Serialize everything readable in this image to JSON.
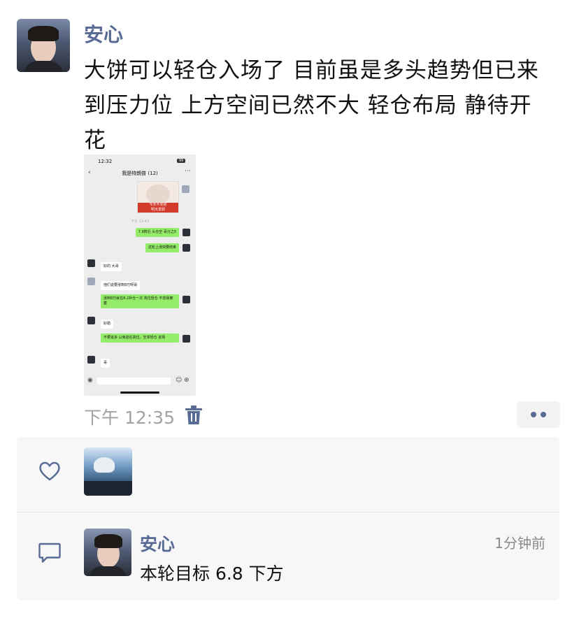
{
  "post": {
    "author": "安心",
    "text_lines": [
      "大饼可以轻仓入场了     目前虽是多头趋势但已来",
      "到压力位  上方空间已然不大   轻仓布局  静待开",
      "花"
    ],
    "time": "下午 12:35",
    "icons": {
      "delete": "trash-icon",
      "more": "more-dots-icon"
    }
  },
  "screenshot": {
    "status_time": "12:32",
    "battery": "99",
    "chat_title": "我是特朗普 (12)",
    "meme_text": [
      "今天不发财",
      "明天发财"
    ],
    "system_note": "下午 12:43",
    "messages": [
      {
        "side": "right",
        "text": "7.9附近 头仓空 百分之5"
      },
      {
        "side": "right",
        "text": "这轮上涨快要结束"
      },
      {
        "side": "left",
        "text": "好的 大哥"
      },
      {
        "side": "left",
        "text": "他们说要涨到8万呀哥"
      },
      {
        "side": "right",
        "text": "涨到8万就在8.2补仓一次 高位轻仓 不容易被套"
      },
      {
        "side": "left",
        "text": "好勒"
      },
      {
        "side": "right",
        "text": "不要追多 以免挂在高位。空单轻仓 进场"
      },
      {
        "side": "left",
        "text": "哥"
      }
    ]
  },
  "likes": {
    "icon": "heart-icon"
  },
  "comment": {
    "icon": "comment-icon",
    "author": "安心",
    "time": "1分钟前",
    "text": "本轮目标 6.8 下方"
  },
  "colors": {
    "link_blue": "#576b95",
    "wechat_green": "#95ec69",
    "panel_bg": "#f7f7f7"
  }
}
